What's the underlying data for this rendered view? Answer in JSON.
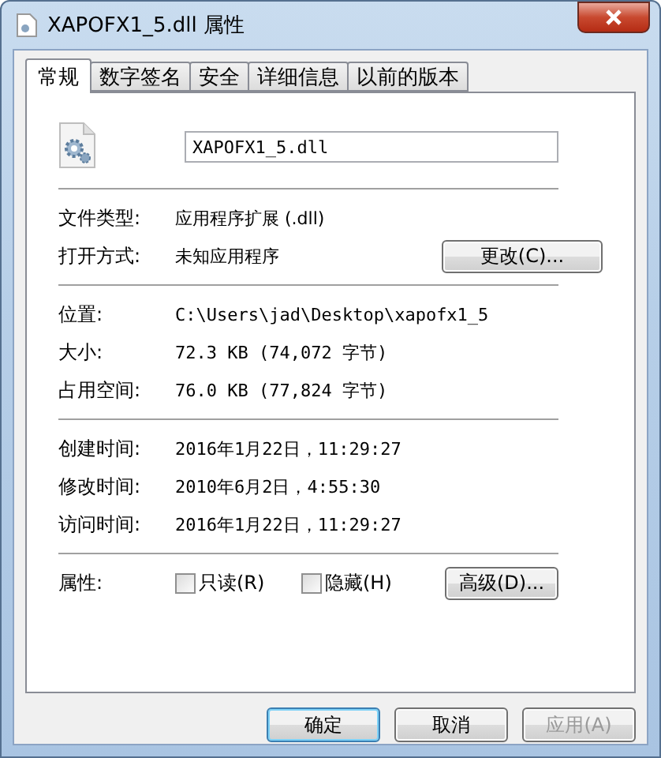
{
  "window": {
    "title": "XAPOFX1_5.dll 属性"
  },
  "tabs": [
    {
      "label": "常规",
      "selected": true
    },
    {
      "label": "数字签名",
      "selected": false
    },
    {
      "label": "安全",
      "selected": false
    },
    {
      "label": "详细信息",
      "selected": false
    },
    {
      "label": "以前的版本",
      "selected": false
    }
  ],
  "file_name": "XAPOFX1_5.dll",
  "sections": [
    [
      {
        "label": "文件类型:",
        "value": "应用程序扩展 (.dll)"
      },
      {
        "label": "打开方式:",
        "value": "未知应用程序",
        "button": "更改(C)..."
      }
    ],
    [
      {
        "label": "位置:",
        "value": "C:\\Users\\jad\\Desktop\\xapofx1_5",
        "mono": true
      },
      {
        "label": "大小:",
        "value": "72.3 KB (74,072 字节)",
        "mono": true
      },
      {
        "label": "占用空间:",
        "value": "76.0 KB (77,824 字节)",
        "mono": true
      }
    ],
    [
      {
        "label": "创建时间:",
        "value": "2016年1月22日，11:29:27",
        "mono": true
      },
      {
        "label": "修改时间:",
        "value": "2010年6月2日，4:55:30",
        "mono": true
      },
      {
        "label": "访问时间:",
        "value": "2016年1月22日，11:29:27",
        "mono": true
      }
    ]
  ],
  "attributes": {
    "label": "属性:",
    "checkboxes": [
      {
        "label": "只读(R)",
        "checked": false
      },
      {
        "label": "隐藏(H)",
        "checked": false
      }
    ],
    "button": "高级(D)..."
  },
  "buttons": [
    {
      "label": "确定",
      "default": true,
      "disabled": false
    },
    {
      "label": "取消",
      "default": false,
      "disabled": false
    },
    {
      "label": "应用(A)",
      "default": false,
      "disabled": true
    }
  ]
}
